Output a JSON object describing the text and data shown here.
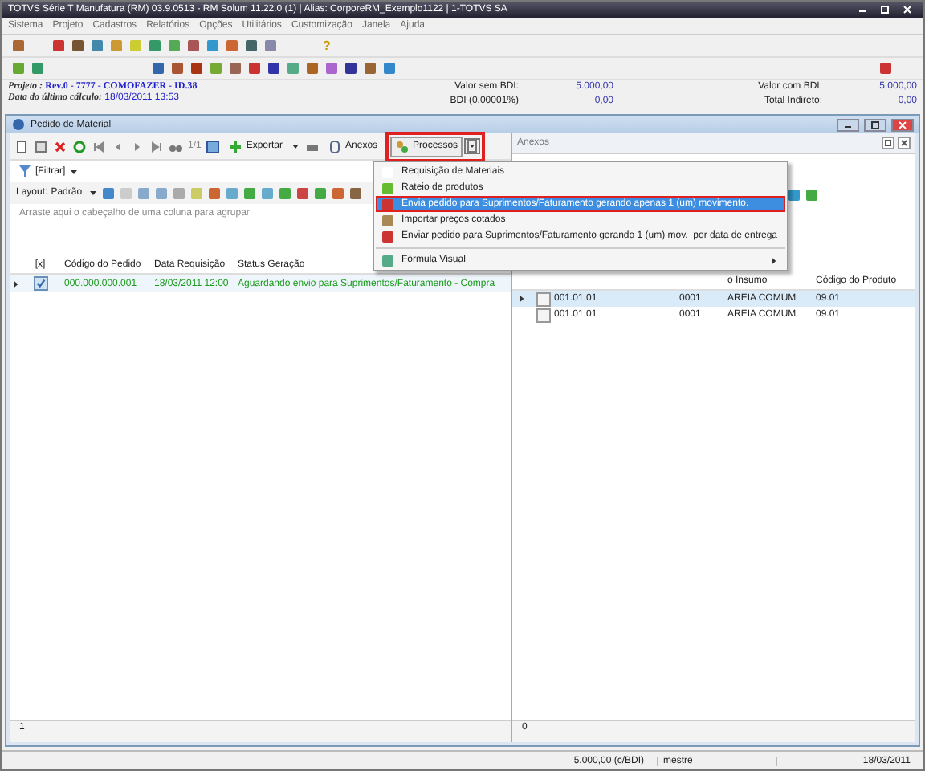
{
  "window": {
    "title": "TOTVS Série T Manufatura (RM) 03.9.0513 - RM Solum 11.22.0 (1) | Alias: CorporeRM_Exemplo1122 | 1-TOTVS SA"
  },
  "menu": [
    "Sistema",
    "Projeto",
    "Cadastros",
    "Relatórios",
    "Opções",
    "Utilitários",
    "Customização",
    "Janela",
    "Ajuda"
  ],
  "help_mark": "?",
  "project": {
    "label": "Projeto :",
    "value": "Rev.0 - 7777 - COMOFAZER - ID.38"
  },
  "last_calc": {
    "label": "Data do último cálculo:",
    "value": "18/03/2011 13:53"
  },
  "totals": [
    {
      "label": "Valor sem BDI:",
      "value": "5.000,00"
    },
    {
      "label": "BDI (0,00001%)",
      "value": "0,00"
    },
    {
      "label": "Valor com BDI:",
      "value": "5.000,00"
    },
    {
      "label": "Total Indireto:",
      "value": "0,00"
    }
  ],
  "child_window": {
    "title": "Pedido de Material"
  },
  "toolbar": {
    "page": "1/1",
    "export": "Exportar",
    "attachments": "Anexos",
    "processes": "Processos",
    "processes_highlighted": true
  },
  "filter": "[Filtrar]",
  "layout": {
    "label": "Layout:",
    "value": "Padrão"
  },
  "group_hint": "Arraste aqui o cabeçalho de uma coluna para agrupar",
  "table": {
    "check_header": "[x]",
    "columns": [
      "Código do Pedido",
      "Data Requisição",
      "Status Geração"
    ],
    "rows": [
      {
        "selected": true,
        "checked": true,
        "cells": [
          "000.000.000.001",
          "18/03/2011 12:00",
          "Aguardando envio para Suprimentos/Faturamento - Compra"
        ]
      }
    ]
  },
  "table_footer": "1",
  "attachments_panel": {
    "title": "Anexos",
    "material_header": "o Insumo",
    "product_header": "Código do Produto",
    "rows": [
      {
        "selected": true,
        "checked": false,
        "code": "001.01.01",
        "number": "0001",
        "material": "AREIA COMUM",
        "product": "09.01"
      },
      {
        "selected": false,
        "checked": false,
        "code": "001.01.01",
        "number": "0001",
        "material": "AREIA COMUM",
        "product": "09.01"
      }
    ],
    "footer": "0"
  },
  "processes_menu": [
    {
      "kind": "item",
      "label": "Requisição de Materiais",
      "selected": false,
      "highlighted": false
    },
    {
      "kind": "item",
      "label": "Rateio de produtos",
      "selected": false,
      "highlighted": false
    },
    {
      "kind": "item",
      "label": "Envia pedido para Suprimentos/Faturamento gerando apenas 1 (um) movimento.",
      "selected": true,
      "highlighted": true
    },
    {
      "kind": "item",
      "label": "Importar preços cotados",
      "selected": false,
      "highlighted": false
    },
    {
      "kind": "item",
      "label": "Enviar pedido para Suprimentos/Faturamento gerando 1 (um) mov.  por data de entrega",
      "selected": false,
      "highlighted": false
    },
    {
      "kind": "submenu",
      "label": "Fórmula Visual",
      "selected": false,
      "highlighted": false
    }
  ],
  "status_bar": [
    "5.000,00 (c/BDI)",
    "mestre",
    "18/03/2011"
  ]
}
